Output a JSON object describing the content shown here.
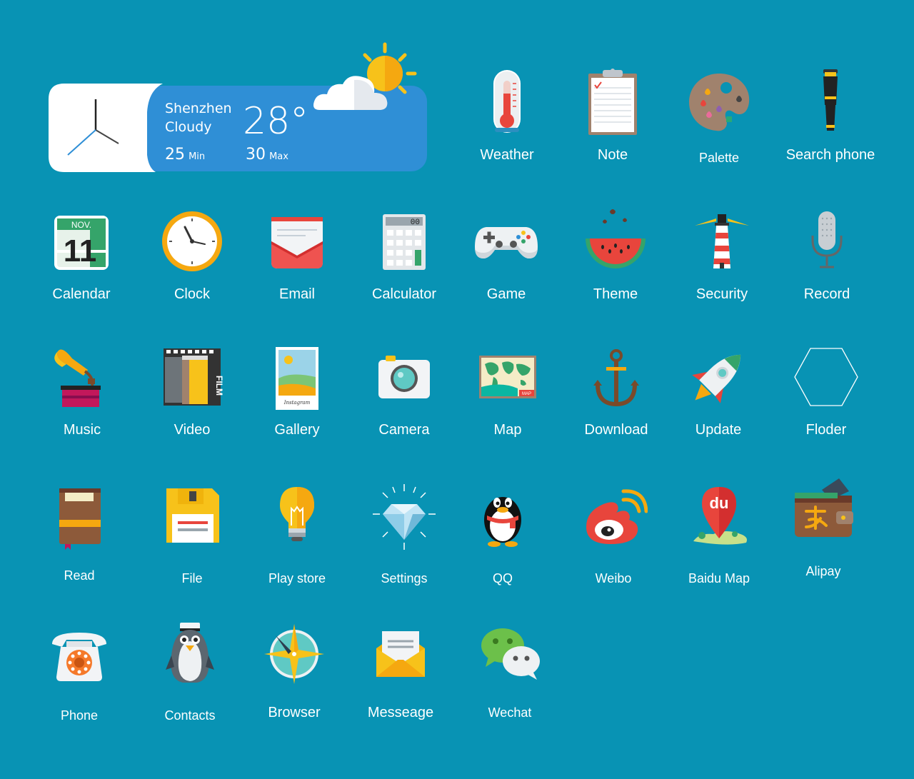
{
  "widget": {
    "city": "Shenzhen",
    "condition": "Cloudy",
    "temp": "28°",
    "min_value": "25",
    "min_label": "Min",
    "max_value": "30",
    "max_label": "Max"
  },
  "apps": [
    {
      "label": "Weather",
      "icon": "thermometer-icon"
    },
    {
      "label": "Note",
      "icon": "clipboard-icon"
    },
    {
      "label": "Palette",
      "icon": "palette-icon"
    },
    {
      "label": "Search phone",
      "icon": "telescope-icon"
    },
    {
      "label": "Calendar",
      "icon": "calendar-icon",
      "month": "NOV.",
      "day": "11"
    },
    {
      "label": "Clock",
      "icon": "clock-icon"
    },
    {
      "label": "Email",
      "icon": "envelope-icon"
    },
    {
      "label": "Calculator",
      "icon": "calculator-icon",
      "display": "00"
    },
    {
      "label": "Game",
      "icon": "gamepad-icon"
    },
    {
      "label": "Theme",
      "icon": "watermelon-icon"
    },
    {
      "label": "Security",
      "icon": "lighthouse-icon"
    },
    {
      "label": "Record",
      "icon": "microphone-icon"
    },
    {
      "label": "Music",
      "icon": "gramophone-icon"
    },
    {
      "label": "Video",
      "icon": "film-icon",
      "film_text": "FILM"
    },
    {
      "label": "Gallery",
      "icon": "polaroid-icon",
      "photo_caption": "Instagram"
    },
    {
      "label": "Camera",
      "icon": "camera-icon"
    },
    {
      "label": "Map",
      "icon": "world-map-icon",
      "map_tag": "MAP"
    },
    {
      "label": "Download",
      "icon": "anchor-icon"
    },
    {
      "label": "Update",
      "icon": "rocket-icon"
    },
    {
      "label": "Floder",
      "icon": "hexagon-icon"
    },
    {
      "label": "Read",
      "icon": "book-icon"
    },
    {
      "label": "File",
      "icon": "floppy-disk-icon"
    },
    {
      "label": "Play store",
      "icon": "lightbulb-icon"
    },
    {
      "label": "Settings",
      "icon": "diamond-icon"
    },
    {
      "label": "QQ",
      "icon": "qq-penguin-icon"
    },
    {
      "label": "Weibo",
      "icon": "weibo-icon"
    },
    {
      "label": "Baidu Map",
      "icon": "baidu-map-pin-icon",
      "pin_text": "du"
    },
    {
      "label": "Alipay",
      "icon": "wallet-icon"
    },
    {
      "label": "Phone",
      "icon": "rotary-phone-icon"
    },
    {
      "label": "Contacts",
      "icon": "penguin-icon"
    },
    {
      "label": "Browser",
      "icon": "compass-icon"
    },
    {
      "label": "Messeage",
      "icon": "letter-icon"
    },
    {
      "label": "Wechat",
      "icon": "wechat-icon"
    }
  ]
}
